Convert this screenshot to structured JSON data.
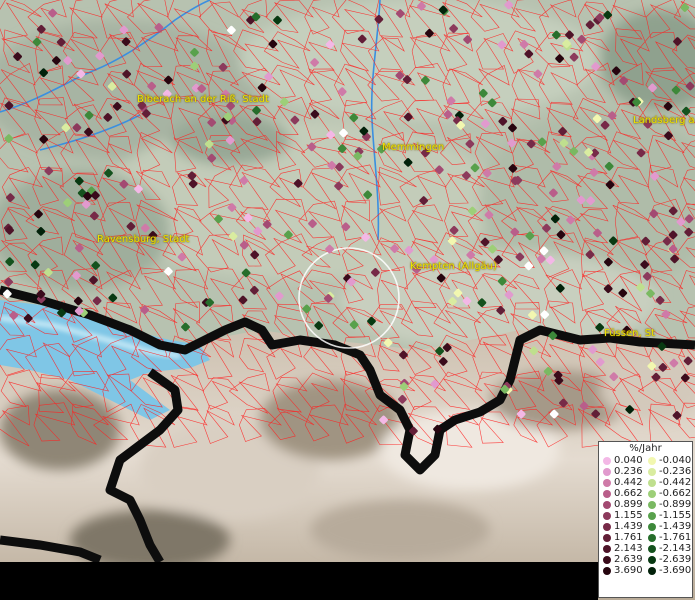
{
  "legend": {
    "title": "%/Jahr",
    "positive": [
      {
        "value": "0.040",
        "color": "#f3b8e6"
      },
      {
        "value": "0.236",
        "color": "#e19ace"
      },
      {
        "value": "0.442",
        "color": "#cf7aa8"
      },
      {
        "value": "0.662",
        "color": "#b95e8a"
      },
      {
        "value": "0.899",
        "color": "#a34a72"
      },
      {
        "value": "1.155",
        "color": "#8c3a5c"
      },
      {
        "value": "1.439",
        "color": "#772a48"
      },
      {
        "value": "1.761",
        "color": "#621e37"
      },
      {
        "value": "2.143",
        "color": "#4e1328"
      },
      {
        "value": "2.639",
        "color": "#3a0b1b"
      },
      {
        "value": "3.690",
        "color": "#26050f"
      }
    ],
    "negative": [
      {
        "value": "-0.040",
        "color": "#f2f7b0"
      },
      {
        "value": "-0.236",
        "color": "#d9eca0"
      },
      {
        "value": "-0.442",
        "color": "#bfdf8e"
      },
      {
        "value": "-0.662",
        "color": "#9dcf78"
      },
      {
        "value": "-0.899",
        "color": "#7ab962"
      },
      {
        "value": "-1.155",
        "color": "#58a14c"
      },
      {
        "value": "-1.439",
        "color": "#3d883a"
      },
      {
        "value": "-1.761",
        "color": "#266d2b"
      },
      {
        "value": "-2.143",
        "color": "#14521d"
      },
      {
        "value": "-2.639",
        "color": "#083912"
      },
      {
        "value": "-3.690",
        "color": "#02210a"
      }
    ]
  },
  "places": [
    {
      "name": "Biberach an der Riß, Stadt"
    },
    {
      "name": "Memmingen"
    },
    {
      "name": "Landsberg a"
    },
    {
      "name": "Ravensburg, Stadt"
    },
    {
      "name": "Kempten (Allgäu)"
    },
    {
      "name": "Füssen, St"
    }
  ],
  "colors": {
    "border": "#ff2020",
    "river": "#3a8fe0",
    "lake": "#7fc6e6",
    "national_border": "#111111"
  }
}
